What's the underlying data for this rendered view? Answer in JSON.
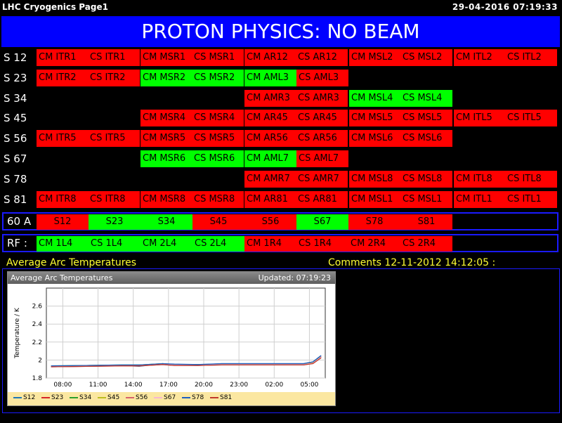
{
  "window": {
    "title": "LHC Cryogenics Page1",
    "datetime": "29-04-2016 07:19:33"
  },
  "banner": {
    "text": "PROTON PHYSICS: NO BEAM"
  },
  "colors": {
    "red": "#ff0000",
    "green": "#00ff00",
    "banner": "#0000ff",
    "yellow": "#ffff33"
  },
  "rows": [
    {
      "label": "S 12",
      "cells": [
        {
          "col": 0,
          "a": "CM ITR1",
          "b": "CS ITR1",
          "status": "red"
        },
        {
          "col": 1,
          "a": "CM MSR1",
          "b": "CS MSR1",
          "status": "red"
        },
        {
          "col": 2,
          "a": "CM AR12",
          "b": "CS AR12",
          "status": "red"
        },
        {
          "col": 3,
          "a": "CM MSL2",
          "b": "CS MSL2",
          "status": "red"
        },
        {
          "col": 4,
          "a": "CM ITL2",
          "b": "CS ITL2",
          "status": "red"
        }
      ]
    },
    {
      "label": "S 23",
      "cells": [
        {
          "col": 0,
          "a": "CM ITR2",
          "b": "CS ITR2",
          "status": "red"
        },
        {
          "col": 1,
          "a": "CM MSR2",
          "b": "CS MSR2",
          "status": "green"
        },
        {
          "col": 2,
          "a": "CM AML3",
          "b": "CS AML3",
          "status": "split"
        }
      ]
    },
    {
      "label": "S 34",
      "cells": [
        {
          "col": 2,
          "a": "CM AMR3",
          "b": "CS AMR3",
          "status": "red"
        },
        {
          "col": 3,
          "a": "CM MSL4",
          "b": "CS MSL4",
          "status": "green"
        }
      ]
    },
    {
      "label": "S 45",
      "cells": [
        {
          "col": 1,
          "a": "CM MSR4",
          "b": "CS MSR4",
          "status": "red"
        },
        {
          "col": 2,
          "a": "CM AR45",
          "b": "CS AR45",
          "status": "red"
        },
        {
          "col": 3,
          "a": "CM MSL5",
          "b": "CS MSL5",
          "status": "red"
        },
        {
          "col": 4,
          "a": "CM ITL5",
          "b": "CS ITL5",
          "status": "red"
        }
      ]
    },
    {
      "label": "S 56",
      "cells": [
        {
          "col": 0,
          "a": "CM ITR5",
          "b": "CS ITR5",
          "status": "red"
        },
        {
          "col": 1,
          "a": "CM MSR5",
          "b": "CS MSR5",
          "status": "red"
        },
        {
          "col": 2,
          "a": "CM AR56",
          "b": "CS AR56",
          "status": "red"
        },
        {
          "col": 3,
          "a": "CM MSL6",
          "b": "CS MSL6",
          "status": "red"
        }
      ]
    },
    {
      "label": "S 67",
      "cells": [
        {
          "col": 1,
          "a": "CM MSR6",
          "b": "CS MSR6",
          "status": "green"
        },
        {
          "col": 2,
          "a": "CM AML7",
          "b": "CS AML7",
          "status": "split"
        }
      ]
    },
    {
      "label": "S 78",
      "cells": [
        {
          "col": 2,
          "a": "CM AMR7",
          "b": "CS AMR7",
          "status": "red"
        },
        {
          "col": 3,
          "a": "CM MSL8",
          "b": "CS MSL8",
          "status": "red"
        },
        {
          "col": 4,
          "a": "CM ITL8",
          "b": "CS ITL8",
          "status": "red"
        }
      ]
    },
    {
      "label": "S 81",
      "cells": [
        {
          "col": 0,
          "a": "CM ITR8",
          "b": "CS ITR8",
          "status": "red"
        },
        {
          "col": 1,
          "a": "CM MSR8",
          "b": "CS MSR8",
          "status": "red"
        },
        {
          "col": 2,
          "a": "CM AR81",
          "b": "CS AR81",
          "status": "red"
        },
        {
          "col": 3,
          "a": "CM MSL1",
          "b": "CS MSL1",
          "status": "red"
        },
        {
          "col": 4,
          "a": "CM ITL1",
          "b": "CS ITL1",
          "status": "red"
        }
      ]
    }
  ],
  "sixty_a": {
    "label": "60 A",
    "segments": [
      {
        "text": "S12",
        "status": "red"
      },
      {
        "text": "S23",
        "status": "green"
      },
      {
        "text": "S34",
        "status": "green"
      },
      {
        "text": "S45",
        "status": "red"
      },
      {
        "text": "S56",
        "status": "red"
      },
      {
        "text": "S67",
        "status": "green"
      },
      {
        "text": "S78",
        "status": "red"
      },
      {
        "text": "S81",
        "status": "red"
      }
    ]
  },
  "rf": {
    "label": "RF :",
    "segments": [
      {
        "text": "CM 1L4",
        "status": "green"
      },
      {
        "text": "CS 1L4",
        "status": "green"
      },
      {
        "text": "CM 2L4",
        "status": "green"
      },
      {
        "text": "CS 2L4",
        "status": "green"
      },
      {
        "text": "CM 1R4",
        "status": "red"
      },
      {
        "text": "CS 1R4",
        "status": "red"
      },
      {
        "text": "CM 2R4",
        "status": "red"
      },
      {
        "text": "CS 2R4",
        "status": "red"
      }
    ]
  },
  "sections": {
    "arc_title": "Average Arc Temperatures",
    "comments": "Comments 12-11-2012 14:12:05 :"
  },
  "chart": {
    "header_title": "Average Arc Temperatures",
    "updated": "Updated: 07:19:23"
  },
  "chart_data": {
    "type": "line",
    "title": "",
    "ylabel": "Temperature / K",
    "xlabel": "",
    "x_ticks": [
      "08:00",
      "11:00",
      "14:00",
      "17:00",
      "20:00",
      "23:00",
      "02:00",
      "05:00"
    ],
    "y_ticks": [
      "1.8",
      "2",
      "2.2",
      "2.4",
      "2.6"
    ],
    "ylim": [
      1.8,
      2.8
    ],
    "x_hours": [
      7.0,
      10.0,
      13.0,
      14.5,
      16.5,
      17.5,
      19.5,
      21.5,
      25.0,
      28.5,
      29.3,
      30.0
    ],
    "series": [
      {
        "name": "S12",
        "color": "#1f77b4",
        "values": [
          1.93,
          1.935,
          1.94,
          1.93,
          1.96,
          1.95,
          1.945,
          1.96,
          1.96,
          1.96,
          1.98,
          2.05
        ]
      },
      {
        "name": "S23",
        "color": "#d62728",
        "values": [
          1.925,
          1.93,
          1.94,
          1.94,
          1.955,
          1.945,
          1.94,
          1.95,
          1.95,
          1.95,
          1.97,
          2.04
        ]
      },
      {
        "name": "S34",
        "color": "#2ca02c",
        "values": [
          1.935,
          1.94,
          1.945,
          1.945,
          1.96,
          1.95,
          1.95,
          1.955,
          1.955,
          1.955,
          1.975,
          2.035
        ]
      },
      {
        "name": "S45",
        "color": "#bcbd22",
        "values": [
          1.93,
          1.935,
          1.94,
          1.94,
          1.955,
          1.945,
          1.945,
          1.95,
          1.95,
          1.95,
          1.97,
          2.03
        ]
      },
      {
        "name": "S56",
        "color": "#d6616b",
        "values": [
          1.925,
          1.93,
          1.935,
          1.935,
          1.95,
          1.94,
          1.94,
          1.945,
          1.945,
          1.945,
          1.965,
          2.03
        ]
      },
      {
        "name": "S67",
        "color": "#f7b6d2",
        "values": [
          1.93,
          1.935,
          1.94,
          1.94,
          1.955,
          1.945,
          1.945,
          1.95,
          1.95,
          1.95,
          1.965,
          2.035
        ]
      },
      {
        "name": "S78",
        "color": "#1f5fbf",
        "values": [
          1.935,
          1.94,
          1.945,
          1.945,
          1.96,
          1.955,
          1.95,
          1.96,
          1.96,
          1.96,
          1.98,
          2.05
        ]
      },
      {
        "name": "S81",
        "color": "#c0392b",
        "values": [
          1.925,
          1.93,
          1.935,
          1.935,
          1.95,
          1.94,
          1.94,
          1.945,
          1.945,
          1.945,
          1.96,
          2.025
        ]
      }
    ]
  }
}
